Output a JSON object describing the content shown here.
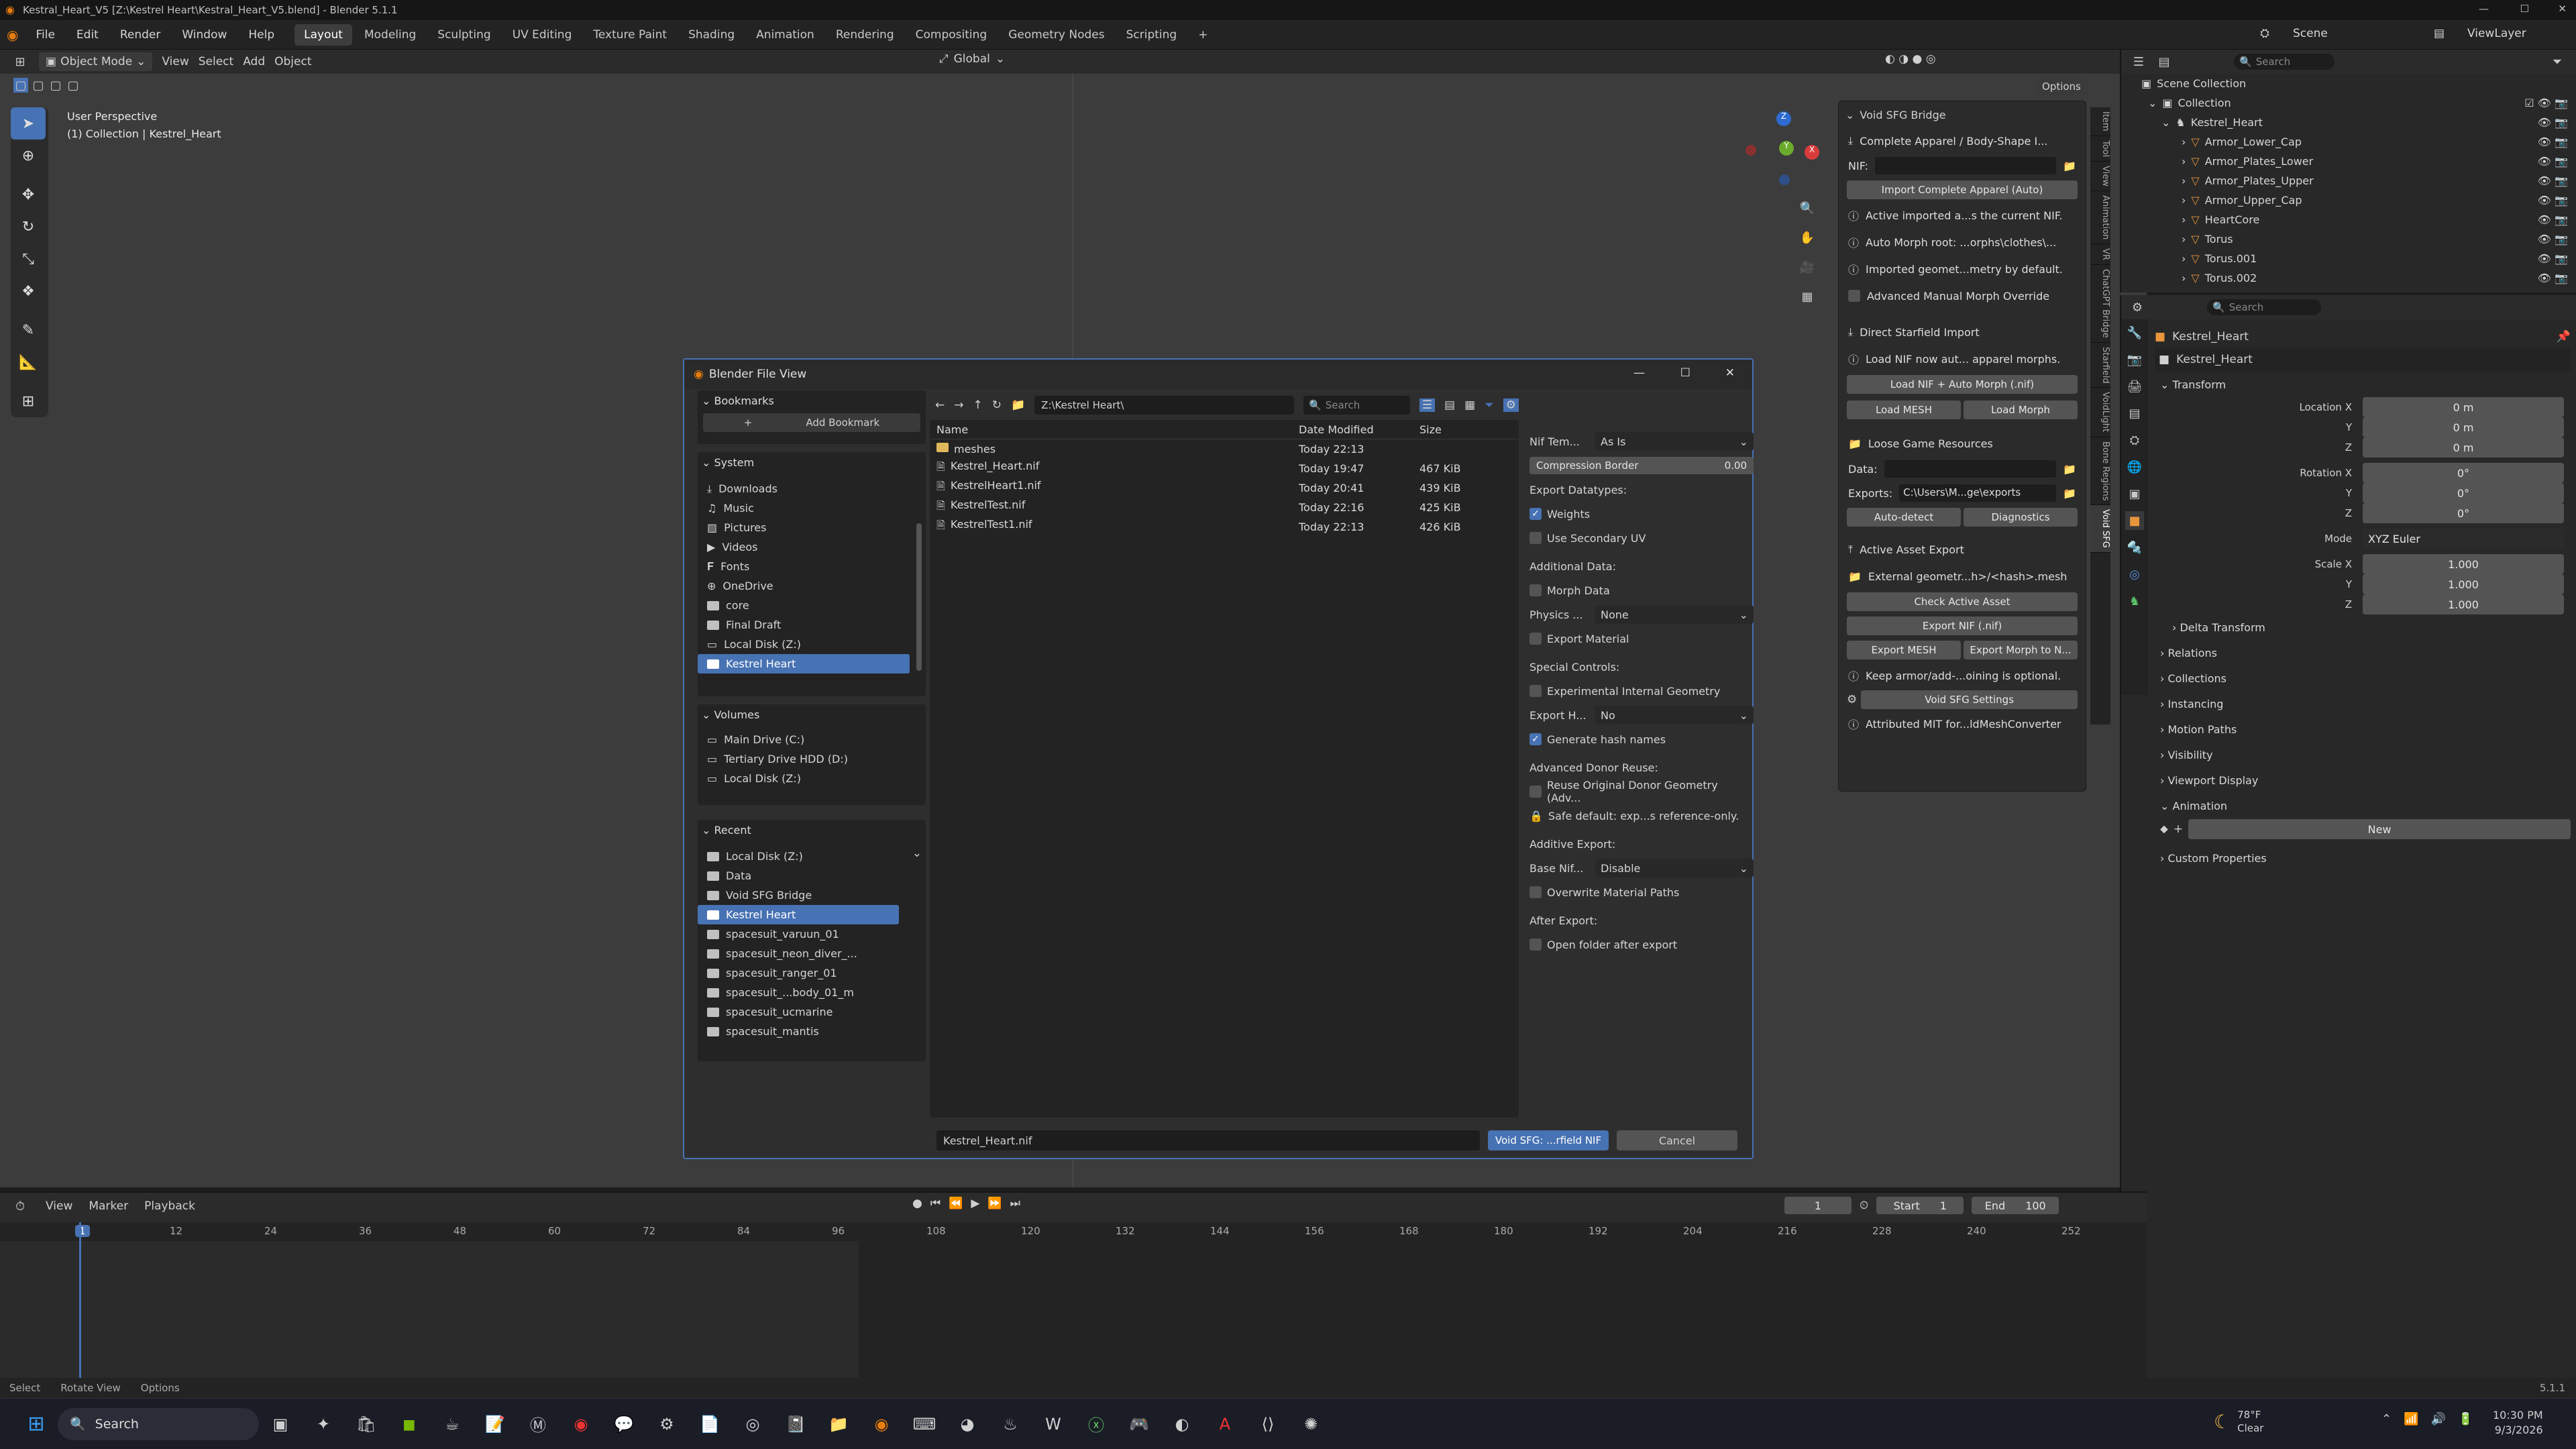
{
  "window": {
    "title": "Kestral_Heart_V5 [Z:\\Kestrel Heart\\Kestral_Heart_V5.blend] - Blender 5.1.1"
  },
  "menu": [
    "File",
    "Edit",
    "Render",
    "Window",
    "Help"
  ],
  "workspaces": [
    "Layout",
    "Modeling",
    "Sculpting",
    "UV Editing",
    "Texture Paint",
    "Shading",
    "Animation",
    "Rendering",
    "Compositing",
    "Geometry Nodes",
    "Scripting"
  ],
  "scene": {
    "name": "Scene",
    "view_layer": "ViewLayer"
  },
  "viewport": {
    "mode": "Object Mode",
    "menus": [
      "View",
      "Select",
      "Add",
      "Object"
    ],
    "orientation": "Global",
    "options": "Options",
    "overlay_title": "User Perspective",
    "overlay_sub": "(1) Collection | Kestrel_Heart"
  },
  "npanel": {
    "title": "Void SFG Bridge",
    "items": [
      "Complete Apparel / Body-Shape I...",
      "NIF:",
      "Import Complete Apparel (Auto)",
      "Active imported a...s the current NIF.",
      "Auto Morph root: ...orphs\\clothes\\...",
      "Imported geomet...metry by default.",
      "Advanced Manual Morph Override",
      "Direct Starfield Import",
      "Load NIF now aut... apparel morphs.",
      "Load NIF + Auto Morph (.nif)",
      "Load MESH",
      "Load Morph",
      "Loose Game Resources",
      "Data:",
      "Exports:",
      "C:\\Users\\M...ge\\exports",
      "Auto-detect",
      "Diagnostics",
      "Active Asset Export",
      "External geometr...h>/<hash>.mesh",
      "Check Active Asset",
      "Export NIF (.nif)",
      "Export MESH",
      "Export Morph to N...",
      "Keep armor/add-...oining is optional.",
      "Void SFG Settings",
      "Attributed MIT for...ldMeshConverter"
    ],
    "tabs": [
      "Item",
      "Tool",
      "View",
      "Animation",
      "VR",
      "ChatGPT Bridge",
      "Starfield",
      "VoidLight",
      "Bone Regions",
      "Void SFG"
    ]
  },
  "outliner": {
    "search": "Search",
    "root": "Scene Collection",
    "collection": "Collection",
    "object": "Kestrel_Heart",
    "children": [
      "Armor_Lower_Cap",
      "Armor_Plates_Lower",
      "Armor_Plates_Upper",
      "Armor_Upper_Cap",
      "HeartCore",
      "Torus",
      "Torus.001",
      "Torus.002"
    ]
  },
  "properties": {
    "search": "Search",
    "object_name": "Kestrel_Heart",
    "data_name": "Kestrel_Heart",
    "transform": "Transform",
    "loc_label": "Location X",
    "loc": [
      "0 m",
      "0 m",
      "0 m"
    ],
    "rot_label": "Rotation X",
    "rot": [
      "0°",
      "0°",
      "0°"
    ],
    "mode_label": "Mode",
    "mode": "XYZ Euler",
    "scale_label": "Scale X",
    "scale": [
      "1.000",
      "1.000",
      "1.000"
    ],
    "axis_y": "Y",
    "axis_z": "Z",
    "sections": [
      "Delta Transform",
      "Relations",
      "Collections",
      "Instancing",
      "Motion Paths",
      "Visibility",
      "Viewport Display",
      "Animation"
    ],
    "new": "New",
    "custom": "Custom Properties"
  },
  "dialog": {
    "title": "Blender File View",
    "bookmarks": "Bookmarks",
    "add_bookmark": "Add Bookmark",
    "system": "System",
    "system_items": [
      "Downloads",
      "Music",
      "Pictures",
      "Videos",
      "Fonts",
      "OneDrive",
      "core",
      "Final Draft",
      "Local Disk (Z:)",
      "Kestrel Heart"
    ],
    "volumes": "Volumes",
    "volume_items": [
      "Main Drive (C:)",
      "Tertiary Drive HDD (D:)",
      "Local Disk (Z:)"
    ],
    "recent": "Recent",
    "recent_items": [
      "Local Disk (Z:)",
      "Data",
      "Void SFG Bridge",
      "Kestrel Heart",
      "spacesuit_varuun_01",
      "spacesuit_neon_diver_...",
      "spacesuit_ranger_01",
      "spacesuit_...body_01_m",
      "spacesuit_ucmarine",
      "spacesuit_mantis"
    ],
    "path": "Z:\\Kestrel Heart\\",
    "search": "Search",
    "cols": {
      "name": "Name",
      "date": "Date Modified",
      "size": "Size"
    },
    "files": [
      {
        "name": "meshes",
        "date": "Today 22:13",
        "size": ""
      },
      {
        "name": "Kestrel_Heart.nif",
        "date": "Today 19:47",
        "size": "467 KiB"
      },
      {
        "name": "KestrelHeart1.nif",
        "date": "Today 20:41",
        "size": "439 KiB"
      },
      {
        "name": "KestrelTest.nif",
        "date": "Today 22:16",
        "size": "425 KiB"
      },
      {
        "name": "KestrelTest1.nif",
        "date": "Today 22:13",
        "size": "426 KiB"
      }
    ],
    "filename": "Kestrel_Heart.nif",
    "confirm": "Void SFG: ...rfield NIF",
    "cancel": "Cancel",
    "opts": {
      "nif_tem": "Nif Tem...",
      "nif_tem_val": "As Is",
      "compression": "Compression Border",
      "compression_val": "0.00",
      "export_dt": "Export Datatypes:",
      "weights": "Weights",
      "secondary_uv": "Use Secondary UV",
      "additional": "Additional Data:",
      "morph": "Morph Data",
      "physics": "Physics ...",
      "physics_val": "None",
      "export_mat": "Export Material",
      "special": "Special Controls:",
      "experimental": "Experimental Internal Geometry",
      "export_h": "Export H...",
      "export_h_val": "No",
      "hash": "Generate hash names",
      "advanced": "Advanced Donor Reuse:",
      "reuse": "Reuse Original Donor Geometry (Adv...",
      "safe": "Safe default: exp...s reference-only.",
      "additive": "Additive Export:",
      "base_nif": "Base Nif...",
      "base_nif_val": "Disable",
      "overwrite": "Overwrite Material Paths",
      "after": "After Export:",
      "open_folder": "Open folder after export"
    }
  },
  "timeline": {
    "menus": [
      "View",
      "Marker",
      "Playback"
    ],
    "frame": "1",
    "start_label": "Start",
    "start": "1",
    "end_label": "End",
    "end": "100",
    "ticks": [
      "1",
      "12",
      "24",
      "36",
      "48",
      "60",
      "72",
      "84",
      "96",
      "108",
      "120",
      "132",
      "144",
      "156",
      "168",
      "180",
      "192",
      "204",
      "216",
      "228",
      "240",
      "252"
    ]
  },
  "statusbar": {
    "select": "Select",
    "rotate": "Rotate View",
    "options": "Options",
    "version": "5.1.1"
  },
  "taskbar": {
    "search": "Search",
    "weather": "78°F",
    "weather_desc": "Clear",
    "time": "10:30 PM",
    "date": "9/3/2026"
  }
}
